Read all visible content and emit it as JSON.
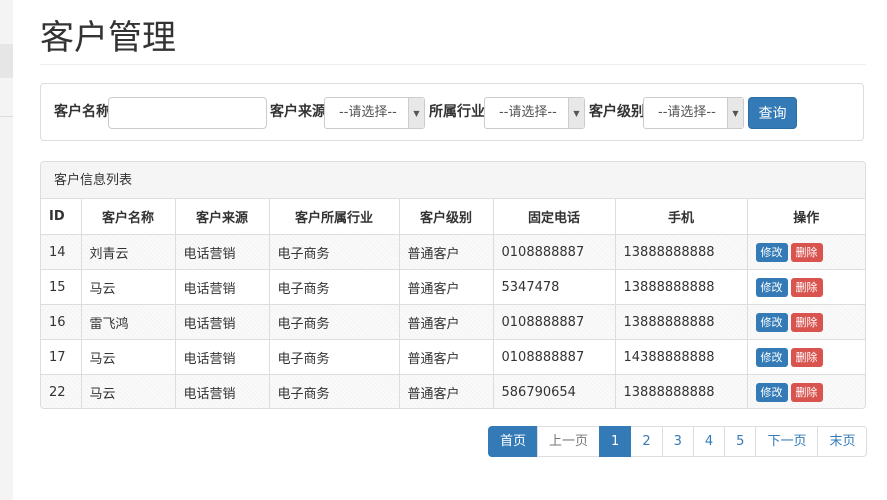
{
  "page": {
    "title": "客户管理"
  },
  "search": {
    "name_label": "客户名称",
    "name_value": "",
    "source_label": "客户来源",
    "source_value": "--请选择--",
    "industry_label": "所属行业",
    "industry_value": "--请选择--",
    "level_label": "客户级别",
    "level_value": "--请选择--",
    "query_label": "查询"
  },
  "list": {
    "panel_title": "客户信息列表",
    "columns": [
      "ID",
      "客户名称",
      "客户来源",
      "客户所属行业",
      "客户级别",
      "固定电话",
      "手机",
      "操作"
    ],
    "edit_label": "修改",
    "delete_label": "删除",
    "rows": [
      {
        "id": "14",
        "name": "刘青云",
        "source": "电话营销",
        "industry": "电子商务",
        "level": "普通客户",
        "phone": "0108888887",
        "mobile": "13888888888"
      },
      {
        "id": "15",
        "name": "马云",
        "source": "电话营销",
        "industry": "电子商务",
        "level": "普通客户",
        "phone": "5347478",
        "mobile": "13888888888"
      },
      {
        "id": "16",
        "name": "雷飞鸿",
        "source": "电话营销",
        "industry": "电子商务",
        "level": "普通客户",
        "phone": "0108888887",
        "mobile": "13888888888"
      },
      {
        "id": "17",
        "name": "马云",
        "source": "电话营销",
        "industry": "电子商务",
        "level": "普通客户",
        "phone": "0108888887",
        "mobile": "14388888888"
      },
      {
        "id": "22",
        "name": "马云",
        "source": "电话营销",
        "industry": "电子商务",
        "level": "普通客户",
        "phone": "586790654",
        "mobile": "13888888888"
      }
    ]
  },
  "pagination": {
    "first": "首页",
    "prev": "上一页",
    "pages": [
      "1",
      "2",
      "3",
      "4",
      "5"
    ],
    "current_page": "1",
    "next": "下一页",
    "last": "末页"
  },
  "colors": {
    "primary": "#337ab7",
    "danger": "#d9534f"
  }
}
